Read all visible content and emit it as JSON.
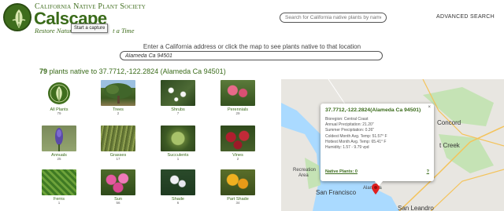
{
  "header": {
    "society": "California Native Plant Society",
    "brand": "Calscape",
    "tagline_left": "Restore Nature",
    "tagline_right": "t a Time",
    "tooltip": "Start a capture",
    "search_placeholder": "Search for California native plants by name",
    "advanced_search": "ADVANCED SEARCH"
  },
  "prompt": {
    "text": "Enter a California address or click the map to see plants native to that location",
    "address_value": "Alameda Ca 94501"
  },
  "result": {
    "count": "79",
    "text": "plants native to 37.7712,-122.2824 (Alameda Ca 94501)"
  },
  "tiles": [
    {
      "label": "All Plants",
      "count": "79"
    },
    {
      "label": "Trees",
      "count": "2"
    },
    {
      "label": "Shrubs",
      "count": "7"
    },
    {
      "label": "Perennials",
      "count": "29"
    },
    {
      "label": "Annuals",
      "count": "25"
    },
    {
      "label": "Grasses",
      "count": "17"
    },
    {
      "label": "Succulents",
      "count": "1"
    },
    {
      "label": "Vines",
      "count": "2"
    },
    {
      "label": "Ferns",
      "count": "1"
    },
    {
      "label": "Sun",
      "count": "56"
    },
    {
      "label": "Shade",
      "count": "6"
    },
    {
      "label": "Part Shade",
      "count": "34"
    }
  ],
  "popup": {
    "title": "37.7712,-122.2824(Alameda Ca 94501)",
    "close": "×",
    "rows": [
      "Bioregion: Central Coast",
      "Annual Precipitation: 21.20\"",
      "Summer Precipitation: 0.26\"",
      "Coldest Month Avg. Temp: 51.57° F",
      "Hottest Month Avg. Temp: 65.41° F",
      "Humidity: 1.57 - 9.79 vpd"
    ],
    "native_plants": "Native Plants: 0",
    "help": "?"
  },
  "map_labels": {
    "concord": "Concord",
    "creek": "t Creek",
    "recreation": "Recreation",
    "area": "Area",
    "sf": "San Francisco",
    "alameda": "Alameda",
    "leandro": "San Leandro"
  },
  "colors": {
    "brand_green": "#3a6b1a",
    "water": "#aadaff",
    "land": "#e8e6e1",
    "park": "#c5e3b5"
  }
}
